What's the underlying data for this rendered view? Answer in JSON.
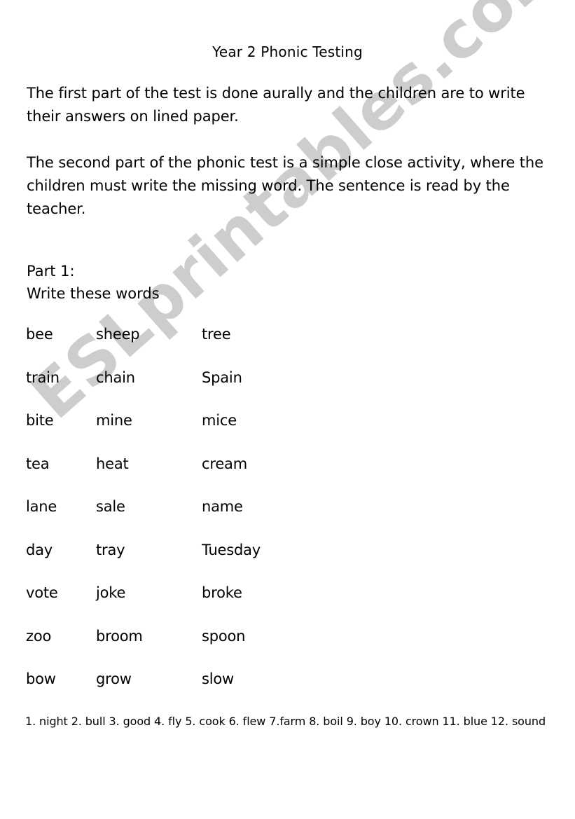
{
  "document": {
    "title": "Year 2 Phonic Testing",
    "paragraphs": [
      "The first part of the test is done aurally and the children are to write their answers on lined paper.",
      "The second part of the phonic test is a simple close activity, where the children must write the missing word. The sentence is read by the teacher."
    ],
    "part_label": "Part 1:",
    "instruction": "Write these words",
    "word_rows": [
      {
        "col1": "bee",
        "col2": "sheep",
        "col3": "tree"
      },
      {
        "col1": "train",
        "col2": "chain",
        "col3": "Spain"
      },
      {
        "col1": "bite",
        "col2": "mine",
        "col3": "mice"
      },
      {
        "col1": "tea",
        "col2": "heat",
        "col3": "cream"
      },
      {
        "col1": "lane",
        "col2": "sale",
        "col3": "name"
      },
      {
        "col1": "day",
        "col2": "tray",
        "col3": "Tuesday"
      },
      {
        "col1": "vote",
        "col2": "joke",
        "col3": "broke"
      },
      {
        "col1": "zoo",
        "col2": "broom",
        "col3": "spoon"
      },
      {
        "col1": "bow",
        "col2": "grow",
        "col3": "slow"
      }
    ],
    "numbered_words": [
      "1. night",
      "2. bull",
      "3. good",
      "4. fly",
      "5. cook",
      "6. flew",
      "7.farm",
      "8. boil",
      "9. boy",
      "10. crown",
      "11. blue",
      "12. sound"
    ],
    "numbered_line": "1. night   2. bull  3. good   4. fly  5. cook 6. flew  7.farm 8. boil 9. boy 10. crown  11. blue 12. sound"
  },
  "watermark": {
    "text": "ESLprintables.com",
    "color": "#cdcdcd"
  },
  "colors": {
    "page_background": "#ffffff",
    "text": "#000000",
    "watermark": "#cdcdcd"
  }
}
